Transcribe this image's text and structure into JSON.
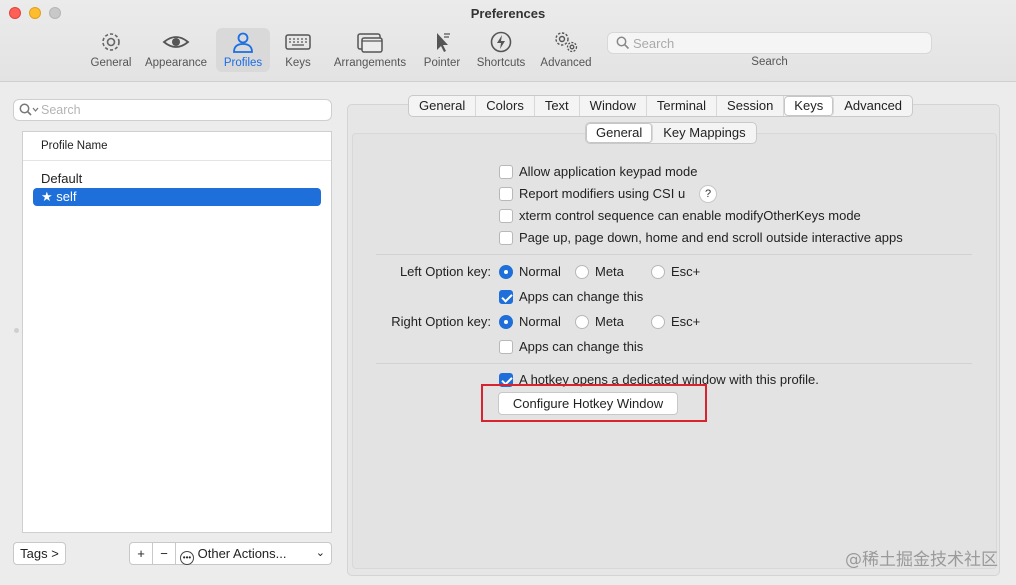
{
  "window": {
    "title": "Preferences"
  },
  "toolbar": {
    "items": [
      {
        "label": "General",
        "icon": "gear-icon"
      },
      {
        "label": "Appearance",
        "icon": "eye-icon"
      },
      {
        "label": "Profiles",
        "icon": "person-icon",
        "active": true
      },
      {
        "label": "Keys",
        "icon": "keyboard-icon"
      },
      {
        "label": "Arrangements",
        "icon": "windows-icon"
      },
      {
        "label": "Pointer",
        "icon": "pointer-icon"
      },
      {
        "label": "Shortcuts",
        "icon": "bolt-icon"
      },
      {
        "label": "Advanced",
        "icon": "gears-icon"
      }
    ],
    "search_placeholder": "Search",
    "search_caption": "Search",
    "accent": "#1a6ee6"
  },
  "sidebar": {
    "search_placeholder": "Search",
    "column_header": "Profile Name",
    "profiles": [
      {
        "name": "Default",
        "selected": false
      },
      {
        "name": "★ self",
        "selected": true
      }
    ],
    "tags_button": "Tags >",
    "add_button": "+",
    "remove_button": "−",
    "other_actions": "Other Actions...",
    "selected_color": "#1e6fd9"
  },
  "main": {
    "tabs": [
      "General",
      "Colors",
      "Text",
      "Window",
      "Terminal",
      "Session",
      "Keys",
      "Advanced"
    ],
    "active_tab": "Keys",
    "subtabs": [
      "General",
      "Key Mappings"
    ],
    "active_subtab": "General",
    "checkboxes": [
      {
        "label": "Allow application keypad mode",
        "checked": false
      },
      {
        "label": "Report modifiers using CSI u",
        "checked": false
      },
      {
        "label": "xterm control sequence can enable modifyOtherKeys mode",
        "checked": false
      },
      {
        "label": "Page up, page down, home and end scroll outside interactive apps",
        "checked": false
      }
    ],
    "help_label": "?",
    "left_option": {
      "label": "Left Option key:",
      "options": [
        "Normal",
        "Meta",
        "Esc+"
      ],
      "selected": "Normal",
      "apps_can_change": {
        "label": "Apps can change this",
        "checked": true
      }
    },
    "right_option": {
      "label": "Right Option key:",
      "options": [
        "Normal",
        "Meta",
        "Esc+"
      ],
      "selected": "Normal",
      "apps_can_change": {
        "label": "Apps can change this",
        "checked": false
      }
    },
    "hotkey": {
      "label": "A hotkey opens a dedicated window with this profile.",
      "checked": true,
      "button": "Configure Hotkey Window"
    },
    "highlight_color": "#d9232e"
  },
  "watermark": "@稀土掘金技术社区"
}
